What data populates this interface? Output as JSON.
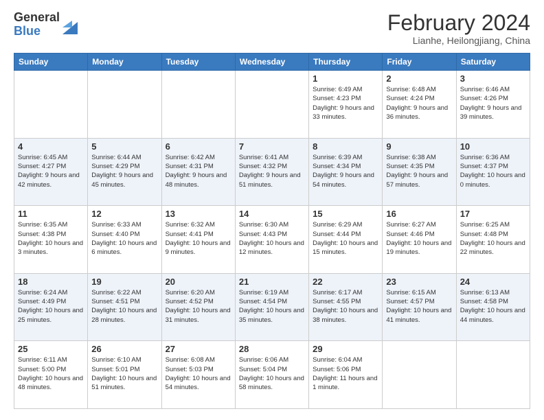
{
  "header": {
    "logo_general": "General",
    "logo_blue": "Blue",
    "title": "February 2024",
    "subtitle": "Lianhe, Heilongjiang, China"
  },
  "weekdays": [
    "Sunday",
    "Monday",
    "Tuesday",
    "Wednesday",
    "Thursday",
    "Friday",
    "Saturday"
  ],
  "weeks": [
    [
      {
        "day": "",
        "info": ""
      },
      {
        "day": "",
        "info": ""
      },
      {
        "day": "",
        "info": ""
      },
      {
        "day": "",
        "info": ""
      },
      {
        "day": "1",
        "info": "Sunrise: 6:49 AM\nSunset: 4:23 PM\nDaylight: 9 hours and 33 minutes."
      },
      {
        "day": "2",
        "info": "Sunrise: 6:48 AM\nSunset: 4:24 PM\nDaylight: 9 hours and 36 minutes."
      },
      {
        "day": "3",
        "info": "Sunrise: 6:46 AM\nSunset: 4:26 PM\nDaylight: 9 hours and 39 minutes."
      }
    ],
    [
      {
        "day": "4",
        "info": "Sunrise: 6:45 AM\nSunset: 4:27 PM\nDaylight: 9 hours and 42 minutes."
      },
      {
        "day": "5",
        "info": "Sunrise: 6:44 AM\nSunset: 4:29 PM\nDaylight: 9 hours and 45 minutes."
      },
      {
        "day": "6",
        "info": "Sunrise: 6:42 AM\nSunset: 4:31 PM\nDaylight: 9 hours and 48 minutes."
      },
      {
        "day": "7",
        "info": "Sunrise: 6:41 AM\nSunset: 4:32 PM\nDaylight: 9 hours and 51 minutes."
      },
      {
        "day": "8",
        "info": "Sunrise: 6:39 AM\nSunset: 4:34 PM\nDaylight: 9 hours and 54 minutes."
      },
      {
        "day": "9",
        "info": "Sunrise: 6:38 AM\nSunset: 4:35 PM\nDaylight: 9 hours and 57 minutes."
      },
      {
        "day": "10",
        "info": "Sunrise: 6:36 AM\nSunset: 4:37 PM\nDaylight: 10 hours and 0 minutes."
      }
    ],
    [
      {
        "day": "11",
        "info": "Sunrise: 6:35 AM\nSunset: 4:38 PM\nDaylight: 10 hours and 3 minutes."
      },
      {
        "day": "12",
        "info": "Sunrise: 6:33 AM\nSunset: 4:40 PM\nDaylight: 10 hours and 6 minutes."
      },
      {
        "day": "13",
        "info": "Sunrise: 6:32 AM\nSunset: 4:41 PM\nDaylight: 10 hours and 9 minutes."
      },
      {
        "day": "14",
        "info": "Sunrise: 6:30 AM\nSunset: 4:43 PM\nDaylight: 10 hours and 12 minutes."
      },
      {
        "day": "15",
        "info": "Sunrise: 6:29 AM\nSunset: 4:44 PM\nDaylight: 10 hours and 15 minutes."
      },
      {
        "day": "16",
        "info": "Sunrise: 6:27 AM\nSunset: 4:46 PM\nDaylight: 10 hours and 19 minutes."
      },
      {
        "day": "17",
        "info": "Sunrise: 6:25 AM\nSunset: 4:48 PM\nDaylight: 10 hours and 22 minutes."
      }
    ],
    [
      {
        "day": "18",
        "info": "Sunrise: 6:24 AM\nSunset: 4:49 PM\nDaylight: 10 hours and 25 minutes."
      },
      {
        "day": "19",
        "info": "Sunrise: 6:22 AM\nSunset: 4:51 PM\nDaylight: 10 hours and 28 minutes."
      },
      {
        "day": "20",
        "info": "Sunrise: 6:20 AM\nSunset: 4:52 PM\nDaylight: 10 hours and 31 minutes."
      },
      {
        "day": "21",
        "info": "Sunrise: 6:19 AM\nSunset: 4:54 PM\nDaylight: 10 hours and 35 minutes."
      },
      {
        "day": "22",
        "info": "Sunrise: 6:17 AM\nSunset: 4:55 PM\nDaylight: 10 hours and 38 minutes."
      },
      {
        "day": "23",
        "info": "Sunrise: 6:15 AM\nSunset: 4:57 PM\nDaylight: 10 hours and 41 minutes."
      },
      {
        "day": "24",
        "info": "Sunrise: 6:13 AM\nSunset: 4:58 PM\nDaylight: 10 hours and 44 minutes."
      }
    ],
    [
      {
        "day": "25",
        "info": "Sunrise: 6:11 AM\nSunset: 5:00 PM\nDaylight: 10 hours and 48 minutes."
      },
      {
        "day": "26",
        "info": "Sunrise: 6:10 AM\nSunset: 5:01 PM\nDaylight: 10 hours and 51 minutes."
      },
      {
        "day": "27",
        "info": "Sunrise: 6:08 AM\nSunset: 5:03 PM\nDaylight: 10 hours and 54 minutes."
      },
      {
        "day": "28",
        "info": "Sunrise: 6:06 AM\nSunset: 5:04 PM\nDaylight: 10 hours and 58 minutes."
      },
      {
        "day": "29",
        "info": "Sunrise: 6:04 AM\nSunset: 5:06 PM\nDaylight: 11 hours and 1 minute."
      },
      {
        "day": "",
        "info": ""
      },
      {
        "day": "",
        "info": ""
      }
    ]
  ]
}
